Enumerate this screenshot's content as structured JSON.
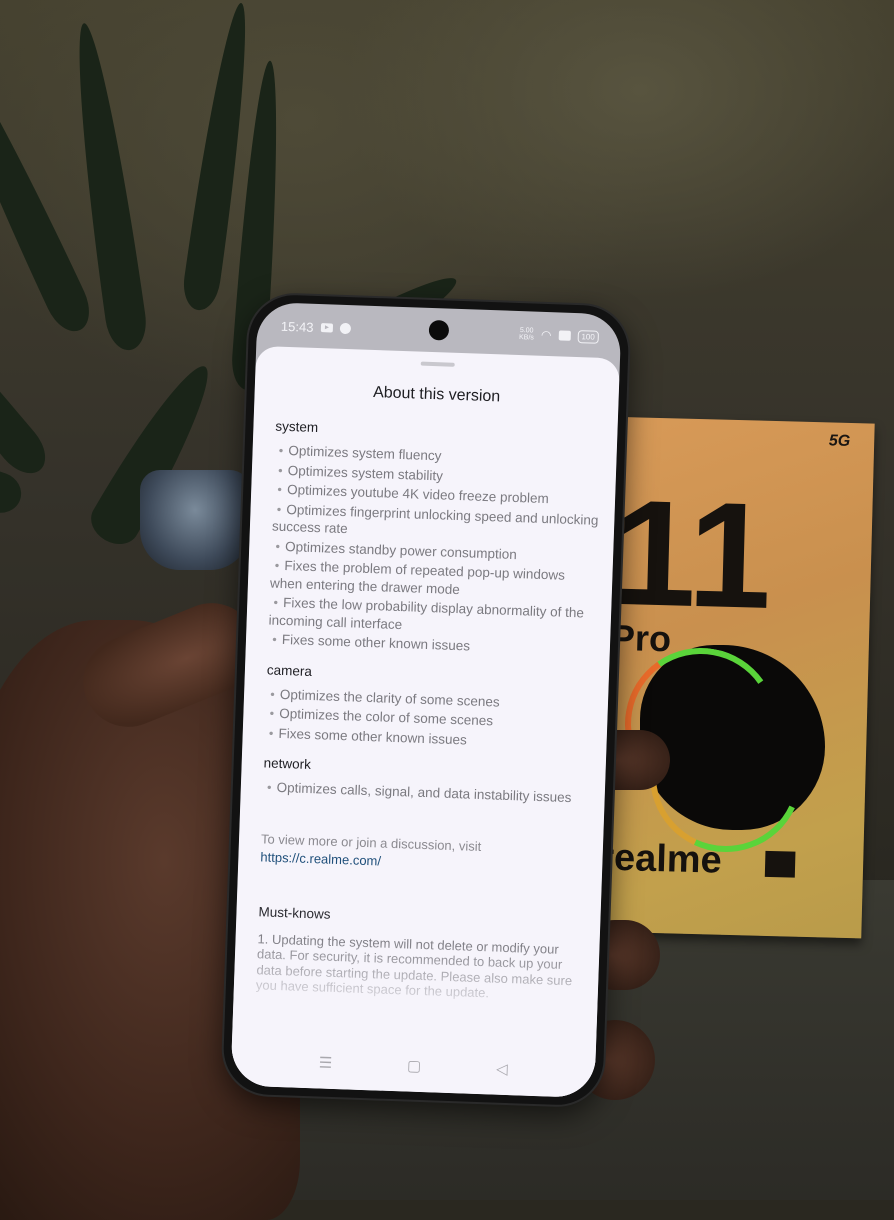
{
  "scene": {
    "description": "Photo of a hand holding a realme phone showing a software update changelog",
    "box": {
      "badge": "5G",
      "model_number": "11",
      "model_suffix": "Pro",
      "brand": "realme"
    }
  },
  "status_bar": {
    "time": "15:43",
    "left_icons": [
      "youtube-icon",
      "spotify-icon"
    ],
    "network_speed": "5.00",
    "network_speed_unit": "KB/s",
    "right_icons": [
      "wifi-icon",
      "sim-icon",
      "battery-icon"
    ],
    "battery": "100"
  },
  "sheet": {
    "title": "About this version",
    "sections": [
      {
        "heading": "system",
        "items": [
          "Optimizes system fluency",
          "Optimizes system stability",
          "Optimizes youtube 4K video freeze problem",
          "Optimizes fingerprint unlocking speed and unlocking success rate",
          "Optimizes standby power consumption",
          "Fixes the problem of repeated pop-up windows when entering the drawer mode",
          "Fixes the low probability display abnormality of the incoming call interface",
          "Fixes some other known issues"
        ]
      },
      {
        "heading": "camera",
        "items": [
          "Optimizes the clarity of some scenes",
          "Optimizes the color of some scenes",
          "Fixes some other known issues"
        ]
      },
      {
        "heading": "network",
        "items": [
          "Optimizes calls, signal, and data instability issues"
        ]
      }
    ],
    "visit_text": "To view more or join a discussion, visit",
    "visit_link": "https://c.realme.com/",
    "link_color": "#1f4f7a",
    "must_knows_heading": "Must-knows",
    "must_knows_body": "1. Updating the system will not delete or modify your data. For security, it is recommended to back up your data before starting the update. Please also make sure you have sufficient space for the update."
  },
  "nav_bar": {
    "menu": "☰",
    "home": "▢",
    "back": "◁"
  }
}
